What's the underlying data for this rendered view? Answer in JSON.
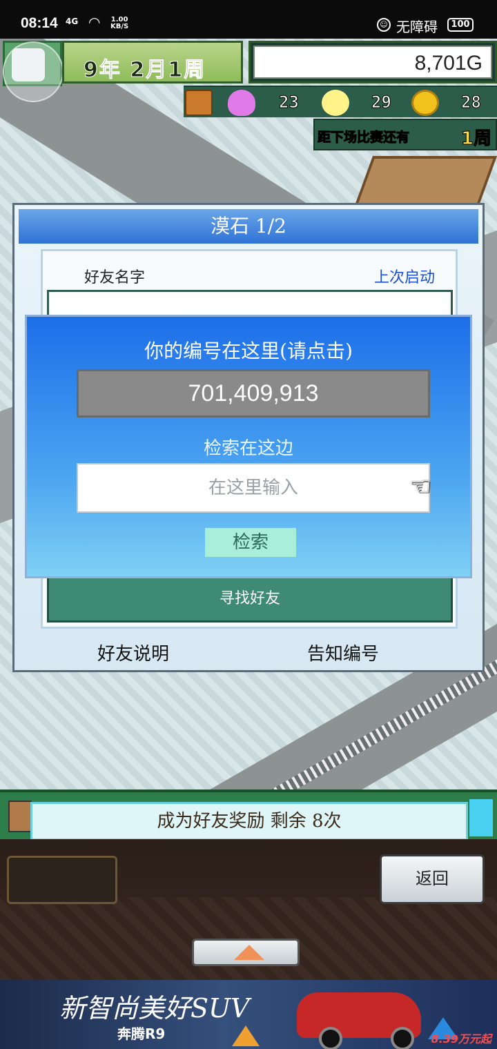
{
  "status_bar": {
    "time": "08:14",
    "network": "4G",
    "speed": "1.00\nKB/S",
    "accessibility_label": "无障碍",
    "battery": "100"
  },
  "hud": {
    "date": "9年 2月1周",
    "money": "8,701G",
    "stats": [
      {
        "icon": "treasure-chest-icon",
        "value": ""
      },
      {
        "icon": "heart-icon",
        "value": "23"
      },
      {
        "icon": "lightbulb-icon",
        "value": "29"
      },
      {
        "icon": "coin-icon",
        "value": "28"
      }
    ],
    "next_match_label": "距下场比赛还有",
    "next_match_weeks": "1周"
  },
  "dialog": {
    "title": "漠石 1/2",
    "col_friend_name": "好友名字",
    "col_last_launch": "上次启动",
    "find_friends": "寻找好友",
    "friend_help": "好友说明",
    "share_id": "告知编号"
  },
  "popup": {
    "your_id_label": "你的编号在这里(请点击)",
    "your_id": "701,409,913",
    "search_label": "检索在这边",
    "search_placeholder": "在这里输入",
    "search_button": "检索"
  },
  "message": {
    "text": "成为好友奖励 剩余 8次"
  },
  "bottom": {
    "back": "返回"
  },
  "ad": {
    "slogan": "新智尚美好SUV",
    "brand": "奔腾R9",
    "price": "8.39万元起"
  },
  "colors": {
    "popup_blue": "#1d6ee8",
    "hud_green": "#2c5d4a",
    "accent_link": "#1c4fd0"
  }
}
